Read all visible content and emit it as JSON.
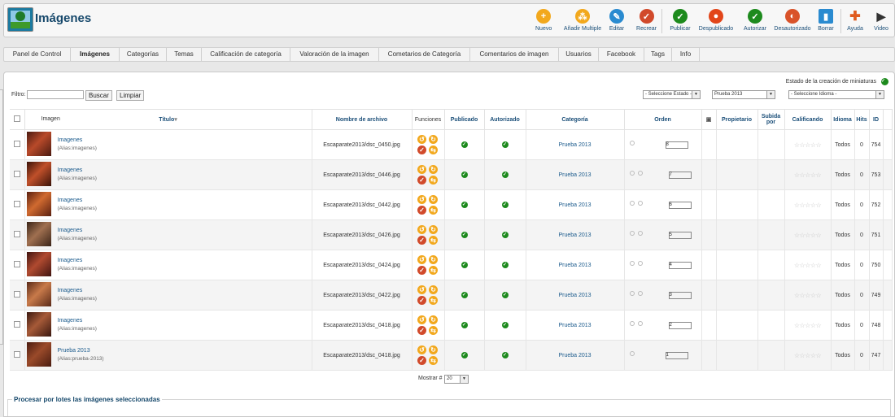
{
  "header": {
    "title": "Imágenes"
  },
  "toolbar": [
    {
      "label": "Nuevo",
      "icon": "plus-icon",
      "color": "#f2a81d",
      "glyph": "+"
    },
    {
      "label": "Añadir Multiple",
      "icon": "multi-add-icon",
      "color": "#f2a81d",
      "glyph": "⁂"
    },
    {
      "label": "Editar",
      "icon": "edit-icon",
      "color": "#2a8bd0",
      "glyph": "✎"
    },
    {
      "label": "Recrear",
      "icon": "recreate-icon",
      "color": "#d14a2b",
      "glyph": "✓"
    },
    {
      "label": "Publicar",
      "icon": "publish-icon",
      "color": "#1d8a1d",
      "glyph": "✓"
    },
    {
      "label": "Despublicado",
      "icon": "unpublish-icon",
      "color": "#e2461a",
      "glyph": "●"
    },
    {
      "label": "Autorizar",
      "icon": "authorize-icon",
      "color": "#1d8a1d",
      "glyph": "✓"
    },
    {
      "label": "Desautorizado",
      "icon": "unauthorize-icon",
      "color": "#d9532a",
      "glyph": "◐"
    },
    {
      "label": "Borrar",
      "icon": "trash-icon",
      "color": "#2a8bd0",
      "glyph": "▮"
    },
    {
      "label": "Ayuda",
      "icon": "help-icon",
      "color": "#e05a1e",
      "glyph": "✚"
    },
    {
      "label": "Video",
      "icon": "video-icon",
      "color": "#333333",
      "glyph": "▶"
    }
  ],
  "nav": [
    "Panel de Control",
    "Imágenes",
    "Categorías",
    "Temas",
    "Calificación de categoría",
    "Valoración de la imagen",
    "Cometarios de Categoría",
    "Comentarios de imagen",
    "Usuarios",
    "Facebook",
    "Tags",
    "Info"
  ],
  "thumbnail_status": "Estado de la creación de miniaturas",
  "filter": {
    "label": "Filtro:",
    "value": "",
    "search_button": "Buscar",
    "clear_button": "Limpiar"
  },
  "selects": {
    "state": "- Seleccione Estado -",
    "category": "Prueba 2013",
    "language": "- Seleccione Idioma -"
  },
  "columns": [
    "Imagen",
    "Título",
    "Nombre de archivo",
    "Funciones",
    "Publicado",
    "Autorizado",
    "Categoría",
    "Orden",
    "Propietario",
    "Subida por",
    "Calificando",
    "Idioma",
    "Hits",
    "ID"
  ],
  "rows": [
    {
      "title": "Imagenes",
      "alias": "(Alias:imagenes)",
      "file": "Escaparate2013/dsc_0450.jpg",
      "category": "Prueba 2013",
      "order": "8",
      "language": "Todos",
      "hits": "0",
      "id": "754",
      "dots": 1
    },
    {
      "title": "Imagenes",
      "alias": "(Alias:imagenes)",
      "file": "Escaparate2013/dsc_0446.jpg",
      "category": "Prueba 2013",
      "order": "7",
      "language": "Todos",
      "hits": "0",
      "id": "753",
      "dots": 2
    },
    {
      "title": "Imagenes",
      "alias": "(Alias:imagenes)",
      "file": "Escaparate2013/dsc_0442.jpg",
      "category": "Prueba 2013",
      "order": "6",
      "language": "Todos",
      "hits": "0",
      "id": "752",
      "dots": 2
    },
    {
      "title": "Imagenes",
      "alias": "(Alias:imagenes)",
      "file": "Escaparate2013/dsc_0426.jpg",
      "category": "Prueba 2013",
      "order": "5",
      "language": "Todos",
      "hits": "0",
      "id": "751",
      "dots": 2
    },
    {
      "title": "Imagenes",
      "alias": "(Alias:imagenes)",
      "file": "Escaparate2013/dsc_0424.jpg",
      "category": "Prueba 2013",
      "order": "4",
      "language": "Todos",
      "hits": "0",
      "id": "750",
      "dots": 2
    },
    {
      "title": "Imagenes",
      "alias": "(Alias:imagenes)",
      "file": "Escaparate2013/dsc_0422.jpg",
      "category": "Prueba 2013",
      "order": "3",
      "language": "Todos",
      "hits": "0",
      "id": "749",
      "dots": 2
    },
    {
      "title": "Imagenes",
      "alias": "(Alias:imagenes)",
      "file": "Escaparate2013/dsc_0418.jpg",
      "category": "Prueba 2013",
      "order": "2",
      "language": "Todos",
      "hits": "0",
      "id": "748",
      "dots": 2
    },
    {
      "title": "Prueba 2013",
      "alias": "(Alias:prueba-2013)",
      "file": "Escaparate2013/dsc_0418.jpg",
      "category": "Prueba 2013",
      "order": "1",
      "language": "Todos",
      "hits": "0",
      "id": "747",
      "dots": 1
    }
  ],
  "pager": {
    "label": "Mostrar #",
    "value": "20"
  },
  "batch": {
    "title": "Procesar por lotes las imágenes seleccionadas"
  }
}
